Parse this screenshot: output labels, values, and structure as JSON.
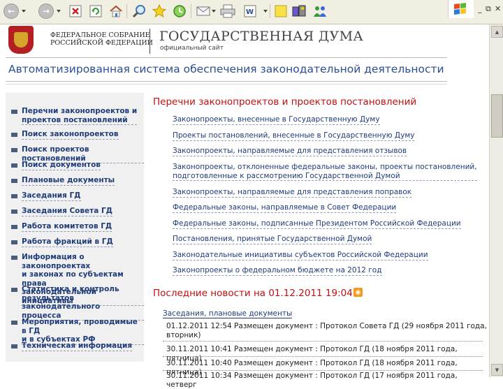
{
  "header": {
    "federal_assembly": [
      "ФЕДЕРАЛЬНОЕ СОБРАНИЕ",
      "РОССИЙСКОЙ ФЕДЕРАЦИИ"
    ],
    "duma_title": "ГОСУДАРСТВЕННАЯ ДУМА",
    "official_site": "официальный сайт",
    "system_title": "Автоматизированная система обеспечения законодательной деятельности"
  },
  "window": {
    "minimize": "_",
    "restore": "⧉",
    "close": "✕"
  },
  "sidebar": {
    "items": [
      {
        "label": "Перечни законопроектов и\nпроектов постановлений"
      },
      {
        "label": "Поиск законопроектов"
      },
      {
        "label": "Поиск проектов постановлений"
      },
      {
        "label": "Поиск документов"
      },
      {
        "label": "Плановые документы"
      },
      {
        "label": "Заседания ГД"
      },
      {
        "label": "Заседания Совета ГД"
      },
      {
        "label": "Работа комитетов ГД"
      },
      {
        "label": "Работа фракций в ГД"
      },
      {
        "label": "Информация о законопроектах\nи законах по субъектам права\nзаконодательной инициативы"
      },
      {
        "label": "Статистика и контроль\nрезультатов законодательного\nпроцесса"
      },
      {
        "label": "Мероприятия, проводимые в ГД\nи в субъектах РФ"
      },
      {
        "label": "Техническая информация"
      }
    ]
  },
  "lists_section": {
    "title": "Перечни законопроектов и проектов постановлений",
    "links": [
      "Законопроекты, внесенные в Государственную Думу",
      "Проекты постановлений, внесенные в Государственную Думу",
      "Законопроекты, направляемые для представления отзывов",
      "Законопроекты, отклоненные федеральные законы, проекты постановлений,\nподготовленные к рассмотрению Государственной Думой",
      "Законопроекты, направляемые для представления поправок",
      "Федеральные законы, направляемые в Совет Федерации",
      "Федеральные законы, подписанные Президентом Российской Федерации",
      "Постановления, принятые Государственной Думой",
      "Законодательные инициативы субъектов Российской Федерации",
      "Законопроекты о федеральном бюджете на 2012 год"
    ]
  },
  "news_section": {
    "title": "Последние новости на 01.12.2011 19:04",
    "category": "Заседания, плановые документы",
    "items": [
      "01.12.2011 12:54 Размещен документ : Протокол Совета ГД (29 ноября 2011 года,\nвторник)",
      "30.11.2011 10:41 Размещен документ : Протокол ГД (18 ноября 2011 года, пятница)",
      "30.11.2011 10:40 Размещен документ : Протокол ГД (18 ноября 2011 года, пятница)",
      "30.11.2011 10:34 Размещен документ : Протокол ГД (17 ноября 2011 года, четверг"
    ]
  },
  "colors": {
    "link": "#1f3c7a",
    "heading_red": "#c01010",
    "title_blue": "#2a4e94",
    "rss_orange": "#f39a1e"
  }
}
